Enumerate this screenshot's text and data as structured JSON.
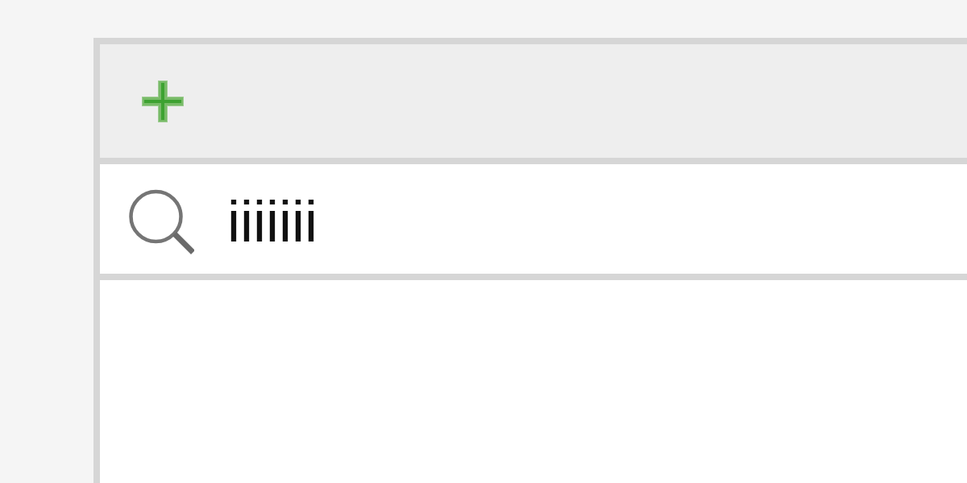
{
  "search": {
    "value": "iiiiiii"
  }
}
